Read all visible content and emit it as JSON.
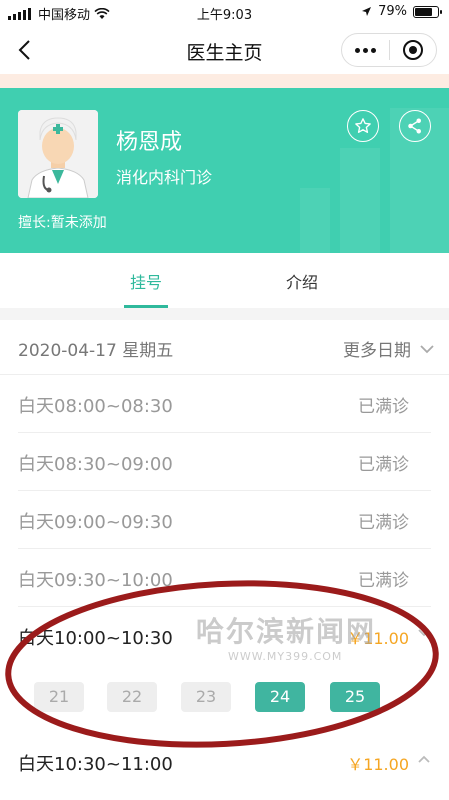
{
  "status_bar": {
    "carrier": "中国移动",
    "time": "上午9:03",
    "battery_pct": "79%",
    "battery_level": 0.79
  },
  "nav": {
    "title": "医生主页"
  },
  "doctor": {
    "name": "杨恩成",
    "department": "消化内科门诊",
    "specialty": "擅长:暂未添加"
  },
  "tabs": [
    {
      "label": "挂号",
      "active": true
    },
    {
      "label": "介绍",
      "active": false
    }
  ],
  "schedule": {
    "date": "2020-04-17 星期五",
    "more_dates": "更多日期",
    "slots": [
      {
        "time": "白天08:00~08:30",
        "status": "已满诊"
      },
      {
        "time": "白天08:30~09:00",
        "status": "已满诊"
      },
      {
        "time": "白天09:00~09:30",
        "status": "已满诊"
      },
      {
        "time": "白天09:30~10:00",
        "status": "已满诊"
      },
      {
        "time": "白天10:00~10:30",
        "price": "￥11.00"
      },
      {
        "time": "白天10:30~11:00",
        "price": "￥11.00"
      }
    ],
    "day_chips": [
      {
        "label": "21",
        "available": false
      },
      {
        "label": "22",
        "available": false
      },
      {
        "label": "23",
        "available": false
      },
      {
        "label": "24",
        "available": true
      },
      {
        "label": "25",
        "available": true
      }
    ]
  },
  "watermark": {
    "text": "哈尔滨新闻网",
    "url": "WWW.MY399.COM"
  },
  "colors": {
    "teal": "#40cfb0",
    "accent": "#2fb99c",
    "price": "#f5a623",
    "annotation": "#9b1b1b"
  }
}
